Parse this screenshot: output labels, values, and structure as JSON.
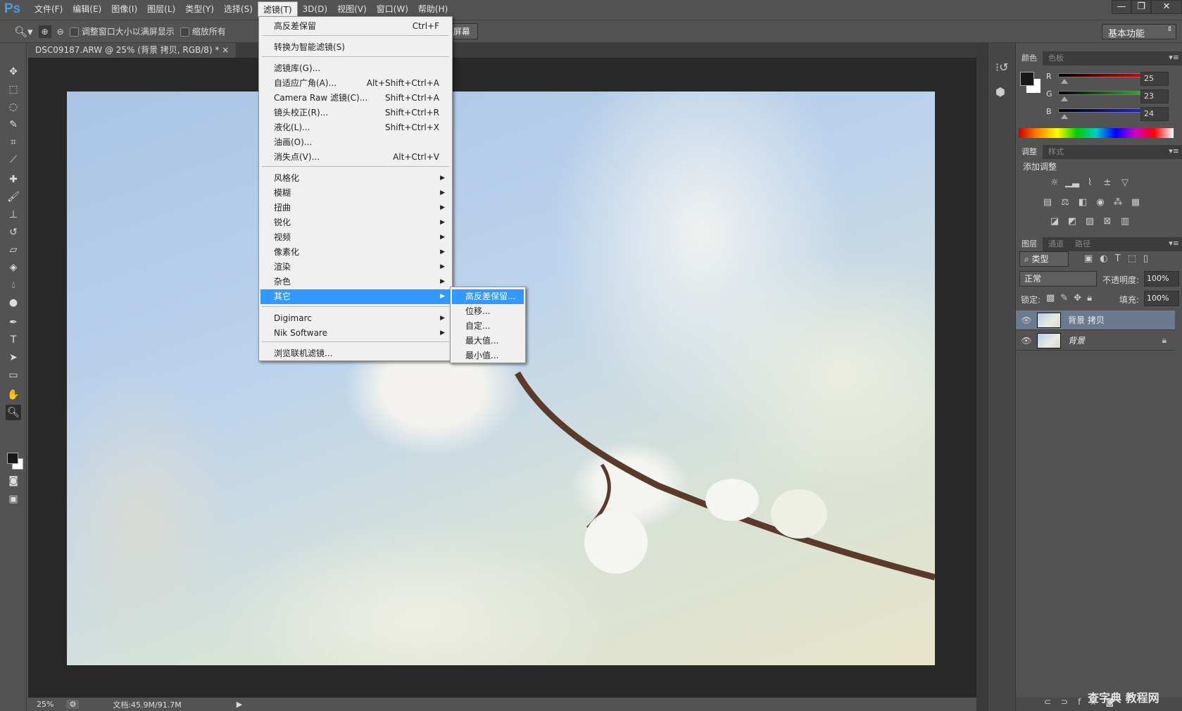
{
  "app": {
    "logo": "Ps",
    "accent": "#3399ff"
  },
  "menubar": [
    "文件(F)",
    "编辑(E)",
    "图像(I)",
    "图层(L)",
    "类型(Y)",
    "选择(S)",
    "滤镜(T)",
    "3D(D)",
    "视图(V)",
    "窗口(W)",
    "帮助(H)"
  ],
  "window_controls": {
    "minimize": "—",
    "restore": "❐",
    "close": "✕"
  },
  "options": {
    "resize_windows": "调整窗口大小以满屏显示",
    "zoom_all": "缩放所有",
    "fill_screen": "填充屏幕",
    "workspace": "基本功能"
  },
  "document_tab": {
    "title": "DSC09187.ARW @ 25% (背景 拷贝, RGB/8) *",
    "close": "×"
  },
  "filter_menu": {
    "items": [
      {
        "label": "高反差保留",
        "shortcut": "Ctrl+F"
      },
      {
        "label": "转换为智能滤镜(S)"
      },
      {
        "label": "滤镜库(G)..."
      },
      {
        "label": "自适应广角(A)...",
        "shortcut": "Alt+Shift+Ctrl+A"
      },
      {
        "label": "Camera Raw 滤镜(C)...",
        "shortcut": "Shift+Ctrl+A"
      },
      {
        "label": "镜头校正(R)...",
        "shortcut": "Shift+Ctrl+R"
      },
      {
        "label": "液化(L)...",
        "shortcut": "Shift+Ctrl+X"
      },
      {
        "label": "油画(O)..."
      },
      {
        "label": "消失点(V)...",
        "shortcut": "Alt+Ctrl+V"
      },
      {
        "label": "风格化",
        "submenu": true
      },
      {
        "label": "模糊",
        "submenu": true
      },
      {
        "label": "扭曲",
        "submenu": true
      },
      {
        "label": "锐化",
        "submenu": true
      },
      {
        "label": "视频",
        "submenu": true
      },
      {
        "label": "像素化",
        "submenu": true
      },
      {
        "label": "渲染",
        "submenu": true
      },
      {
        "label": "杂色",
        "submenu": true
      },
      {
        "label": "其它",
        "submenu": true,
        "highlighted": true
      },
      {
        "label": "Digimarc",
        "submenu": true
      },
      {
        "label": "Nik Software",
        "submenu": true
      },
      {
        "label": "浏览联机滤镜..."
      }
    ]
  },
  "other_submenu": [
    "高反差保留...",
    "位移...",
    "自定...",
    "最大值...",
    "最小值..."
  ],
  "color_panel": {
    "tabs": [
      "颜色",
      "色板"
    ],
    "R": "25",
    "G": "23",
    "B": "24",
    "fg": "#191718",
    "bg": "#ffffff"
  },
  "adjustments_panel": {
    "tabs": [
      "调整",
      "样式"
    ],
    "heading": "添加调整"
  },
  "layers_panel": {
    "tabs": [
      "图层",
      "通道",
      "路径"
    ],
    "filter": "类型",
    "blend_mode": "正常",
    "opacity_label": "不透明度:",
    "opacity": "100%",
    "lock_label": "锁定:",
    "fill_label": "填充:",
    "fill": "100%",
    "layers": [
      {
        "name": "背景 拷贝",
        "selected": true
      },
      {
        "name": "背景",
        "locked": true
      }
    ]
  },
  "status": {
    "zoom": "25%",
    "doc": "文档:45.9M/91.7M"
  },
  "watermark": "查字典 教程网"
}
